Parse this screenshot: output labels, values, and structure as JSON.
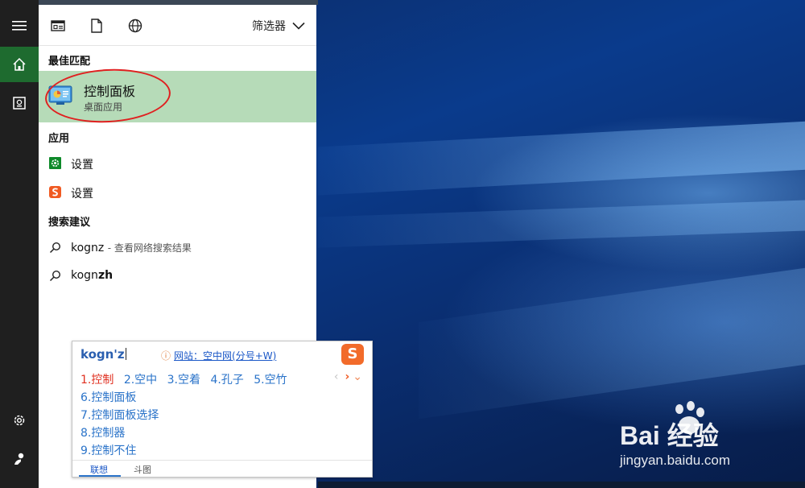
{
  "search_panel": {
    "filter_label": "筛选器",
    "best_match": {
      "title": "最佳匹配",
      "app_name": "控制面板",
      "app_type": "桌面应用"
    },
    "apps": {
      "title": "应用",
      "items": [
        {
          "label": "设置",
          "icon": "settings-green-icon"
        },
        {
          "label": "设置",
          "icon": "sogou-settings-icon"
        }
      ]
    },
    "suggestions": {
      "title": "搜索建议",
      "items": [
        {
          "query": "kognz",
          "hint": "- 查看网络搜索结果"
        },
        {
          "query_plain": "kogn",
          "query_bold": "zh"
        }
      ]
    }
  },
  "ime": {
    "composition": "kogn'z",
    "info_text": "网站：空中网(分号+W)",
    "logo_text": "S",
    "candidates_inline": [
      "1.控制",
      "2.空中",
      "3.空着",
      "4.孔子",
      "5.空竹"
    ],
    "candidates_extra": [
      "6.控制面板",
      "7.控制面板选择",
      "8.控制器",
      "9.控制不住"
    ],
    "pager_prev": "‹",
    "pager_next": "›",
    "pager_expand": "⌄",
    "tabs": [
      "联想",
      "斗图"
    ]
  },
  "watermark": {
    "brand": "Bai  经验",
    "url": "jingyan.baidu.com"
  }
}
